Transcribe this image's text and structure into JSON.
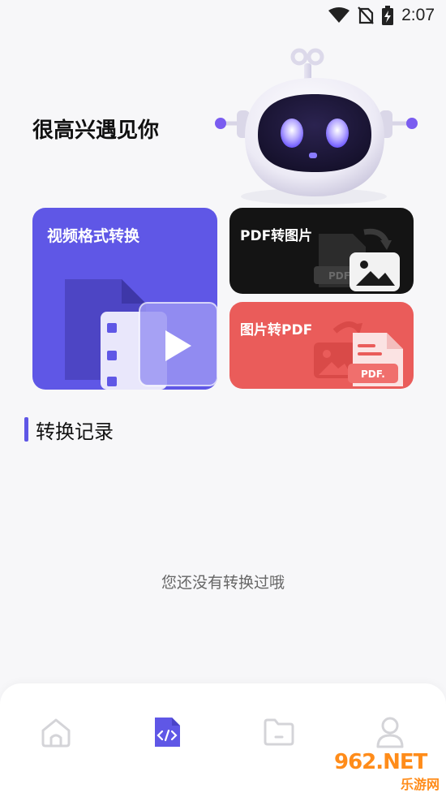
{
  "status_bar": {
    "time": "2:07",
    "icons": [
      "wifi-icon",
      "no-sim-icon",
      "battery-charging-icon"
    ]
  },
  "greeting": "很高兴遇见你",
  "cards": {
    "video_convert": {
      "title": "视频格式转换",
      "color": "#5f57e6"
    },
    "pdf_to_image": {
      "title": "PDF转图片",
      "color": "#141414",
      "badge": "PDF"
    },
    "image_to_pdf": {
      "title": "图片转PDF",
      "color": "#ea5c5a",
      "badge": "PDF."
    }
  },
  "section": {
    "title": "转换记录",
    "accent": "#5f57e6"
  },
  "empty_state": "您还没有转换过哦",
  "bottom_nav": {
    "items": [
      {
        "icon": "home-icon",
        "active": false
      },
      {
        "icon": "code-file-icon",
        "active": true
      },
      {
        "icon": "folder-icon",
        "active": false
      },
      {
        "icon": "user-icon",
        "active": false
      }
    ],
    "active_color": "#5f57e6",
    "inactive_color": "#d4d4d8"
  },
  "watermark": {
    "brand": "962.NET",
    "sub": "乐游网"
  }
}
